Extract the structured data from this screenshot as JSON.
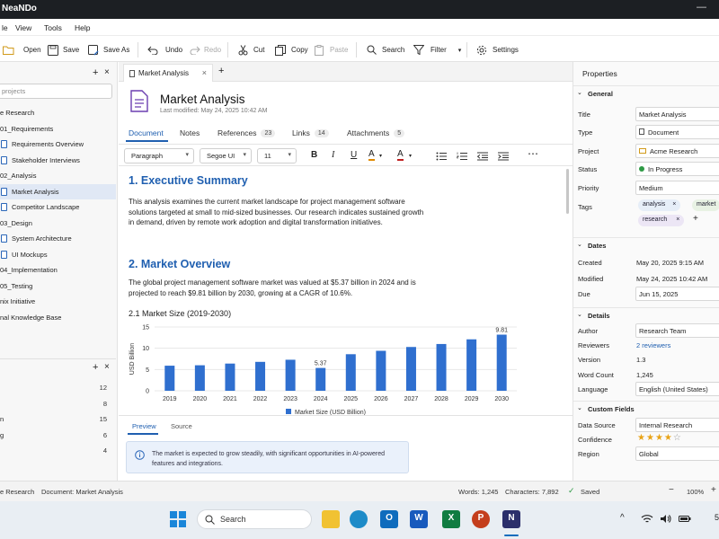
{
  "window": {
    "title": "NeaNDo"
  },
  "menu": [
    "le",
    "View",
    "Tools",
    "Help"
  ],
  "toolbar": {
    "open": "Open",
    "save": "Save",
    "save_as": "Save As",
    "undo": "Undo",
    "redo": "Redo",
    "cut": "Cut",
    "copy": "Copy",
    "paste": "Paste",
    "search": "Search",
    "filter": "Filter",
    "settings": "Settings"
  },
  "sidebar": {
    "search_placeholder": "projects",
    "tree": [
      {
        "label": "e Research"
      },
      {
        "label": "01_Requirements"
      },
      {
        "label": "Requirements Overview"
      },
      {
        "label": "Stakeholder Interviews"
      },
      {
        "label": "02_Analysis"
      },
      {
        "label": "Market Analysis"
      },
      {
        "label": "Competitor Landscape"
      },
      {
        "label": "03_Design"
      },
      {
        "label": "System Architecture"
      },
      {
        "label": "UI Mockups"
      },
      {
        "label": "04_Implementation"
      },
      {
        "label": "05_Testing"
      },
      {
        "label": "nix Initiative"
      },
      {
        "label": "nal Knowledge Base"
      }
    ],
    "counts": [
      {
        "label": "",
        "n": "12"
      },
      {
        "label": "",
        "n": "8"
      },
      {
        "label": "n",
        "n": "15"
      },
      {
        "label": "g",
        "n": "6"
      },
      {
        "label": "",
        "n": "4"
      }
    ]
  },
  "editor": {
    "tab": "Market Analysis",
    "doc_title": "Market Analysis",
    "modified": "Last modified: May 24, 2025 10:42 AM",
    "subtabs": [
      {
        "label": "Document",
        "badge": ""
      },
      {
        "label": "Notes",
        "badge": ""
      },
      {
        "label": "References",
        "badge": "23"
      },
      {
        "label": "Links",
        "badge": "14"
      },
      {
        "label": "Attachments",
        "badge": "5"
      }
    ],
    "format": {
      "style": "Paragraph",
      "font": "Segoe UI",
      "size": "11"
    },
    "h1": "1. Executive Summary",
    "p1": "This analysis examines the current market landscape for project management software solutions targeted at small to mid-sized businesses. Our research indicates sustained growth in demand, driven by remote work adoption and digital transformation initiatives.",
    "h2": "2. Market Overview",
    "p2": "The global project management software market was valued at $5.37 billion in 2024 and is projected to reach $9.81 billion by 2030, growing at a CAGR of 10.6%.",
    "h3": "2.1  Market Size (2019-2030)",
    "preview_tabs": [
      "Preview",
      "Source"
    ],
    "callout": "The market is expected to grow steadily, with significant opportunities in AI-powered features and integrations."
  },
  "chart_data": {
    "type": "bar",
    "categories": [
      "2019",
      "2020",
      "2021",
      "2022",
      "2023",
      "2024",
      "2025",
      "2026",
      "2027",
      "2028",
      "2029",
      "2030"
    ],
    "values": [
      5.9,
      6.0,
      6.4,
      6.8,
      7.3,
      5.37,
      8.6,
      9.4,
      10.3,
      11.0,
      12.1,
      13.2
    ],
    "labeled": {
      "2024": "5.37",
      "2030": "9.81"
    },
    "ylabel": "USD Billion",
    "ylim": [
      0,
      15
    ],
    "yticks": [
      "0",
      "5",
      "10",
      "15"
    ],
    "legend": "Market Size (USD Billion)",
    "color": "#2f6fcf"
  },
  "properties": {
    "header": "Properties",
    "general": "General",
    "title_l": "Title",
    "title_v": "Market Analysis",
    "type_l": "Type",
    "type_v": "Document",
    "project_l": "Project",
    "project_v": "Acme Research",
    "status_l": "Status",
    "status_v": "In Progress",
    "priority_l": "Priority",
    "priority_v": "Medium",
    "tags_l": "Tags",
    "tags": [
      "analysis",
      "market",
      "research"
    ],
    "dates": "Dates",
    "created_l": "Created",
    "created_v": "May 20, 2025 9:15 AM",
    "modified_l": "Modified",
    "modified_v": "May 24, 2025 10:42 AM",
    "due_l": "Due",
    "due_v": "Jun 15, 2025",
    "details": "Details",
    "author_l": "Author",
    "author_v": "Research Team",
    "reviewers_l": "Reviewers",
    "reviewers_v": "2 reviewers",
    "version_l": "Version",
    "version_v": "1.3",
    "wc_l": "Word Count",
    "wc_v": "1,245",
    "lang_l": "Language",
    "lang_v": "English (United States)",
    "custom": "Custom Fields",
    "ds_l": "Data Source",
    "ds_v": "Internal Research",
    "conf_l": "Confidence",
    "conf_stars": 4,
    "conf_max": 5,
    "region_l": "Region",
    "region_v": "Global"
  },
  "status": {
    "project": "e Research",
    "document": "Document:  Market Analysis",
    "words": "Words:  1,245",
    "chars": "Characters:  7,892",
    "saved": "Saved",
    "zoom": "100%"
  },
  "taskbar": {
    "search": "Search",
    "clock_partial": "5"
  }
}
